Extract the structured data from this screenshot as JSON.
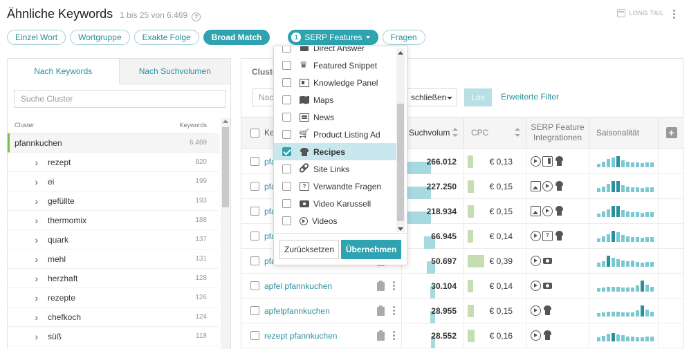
{
  "header": {
    "title": "Ähnliche Keywords",
    "count": "1 bis 25 von 6.469",
    "help": "?",
    "longtail": "LONG TAIL"
  },
  "match_types": [
    "Einzel Wort",
    "Wortgruppe",
    "Exakte Folge",
    "Broad Match"
  ],
  "active_match": "Broad Match",
  "serp_filter": {
    "badge": "1",
    "label": "SERP Features"
  },
  "questions_pill": "Fragen",
  "left": {
    "tabs": [
      "Nach Keywords",
      "Nach Suchvolumen"
    ],
    "search_placeholder": "Suche Cluster",
    "col_cluster": "Cluster",
    "col_keywords": "Keywords",
    "root": {
      "name": "pfannkuchen",
      "count": "6.469"
    },
    "items": [
      {
        "name": "rezept",
        "count": "820"
      },
      {
        "name": "ei",
        "count": "199"
      },
      {
        "name": "gefüllte",
        "count": "193"
      },
      {
        "name": "thermomix",
        "count": "188"
      },
      {
        "name": "quark",
        "count": "137"
      },
      {
        "name": "mehl",
        "count": "131"
      },
      {
        "name": "herzhaft",
        "count": "128"
      },
      {
        "name": "rezepte",
        "count": "126"
      },
      {
        "name": "chefkoch",
        "count": "124"
      },
      {
        "name": "süß",
        "count": "118"
      }
    ]
  },
  "main": {
    "label": "Cluste",
    "search_placeholder": "Nac",
    "exclude_select": "schließen",
    "go_button": "Los",
    "advanced_filter": "Erweiterte Filter",
    "columns": {
      "keyword": "Ke",
      "volume": "Suchvolum",
      "cpc": "CPC",
      "serp": "SERP Feature Integrationen",
      "season": "Saisonalität",
      "add": "+"
    },
    "rows": [
      {
        "kw": "pfa",
        "volume": "266.012",
        "cpc": "€ 0,13",
        "vol_pct": 1.0,
        "cpc_pct": 0.2,
        "icons": [
          "play-icon",
          "panel-icon",
          "chef-hat-icon"
        ],
        "season": [
          5,
          8,
          12,
          14,
          16,
          10,
          8,
          7,
          7,
          6,
          7,
          7
        ]
      },
      {
        "kw": "pfa",
        "volume": "227.250",
        "cpc": "€ 0,15",
        "vol_pct": 0.86,
        "cpc_pct": 0.23,
        "icons": [
          "image-icon",
          "play-icon",
          "chef-hat-icon"
        ],
        "season": [
          6,
          8,
          12,
          16,
          16,
          10,
          8,
          7,
          7,
          6,
          7,
          7
        ]
      },
      {
        "kw": "pfa",
        "volume": "218.934",
        "cpc": "€ 0,15",
        "vol_pct": 0.82,
        "cpc_pct": 0.23,
        "icons": [
          "image-icon",
          "play-icon",
          "chef-hat-icon"
        ],
        "season": [
          5,
          8,
          11,
          16,
          16,
          10,
          8,
          7,
          7,
          6,
          7,
          7
        ]
      },
      {
        "kw": "pfa",
        "volume": "66.945",
        "cpc": "€ 0,14",
        "vol_pct": 0.25,
        "cpc_pct": 0.2,
        "icons": [
          "play-icon",
          "faq-icon",
          "chef-hat-icon"
        ],
        "season": [
          5,
          8,
          11,
          16,
          14,
          10,
          8,
          7,
          7,
          6,
          7,
          7
        ]
      },
      {
        "kw": "pfa",
        "volume": "50.697",
        "cpc": "€ 0,39",
        "vol_pct": 0.19,
        "cpc_pct": 0.6,
        "icons": [
          "play-icon",
          "video-carousel-icon"
        ],
        "season": [
          6,
          8,
          16,
          13,
          11,
          9,
          8,
          9,
          7,
          6,
          7,
          7
        ]
      },
      {
        "kw": "apfel pfannkuchen",
        "volume": "30.104",
        "cpc": "€ 0,14",
        "vol_pct": 0.11,
        "cpc_pct": 0.2,
        "icons": [
          "play-icon",
          "video-carousel-icon"
        ],
        "season": [
          5,
          6,
          7,
          7,
          7,
          6,
          6,
          6,
          9,
          16,
          10,
          7
        ]
      },
      {
        "kw": "apfelpfannkuchen",
        "volume": "28.955",
        "cpc": "€ 0,15",
        "vol_pct": 0.11,
        "cpc_pct": 0.23,
        "icons": [
          "play-icon",
          "chef-hat-icon"
        ],
        "season": [
          5,
          6,
          7,
          7,
          7,
          6,
          6,
          6,
          9,
          16,
          10,
          7
        ]
      },
      {
        "kw": "rezept pfannkuchen",
        "volume": "28.552",
        "cpc": "€ 0,16",
        "vol_pct": 0.1,
        "cpc_pct": 0.25,
        "icons": [
          "play-icon",
          "chef-hat-icon"
        ],
        "season": [
          6,
          8,
          11,
          12,
          10,
          9,
          7,
          7,
          6,
          6,
          7,
          7
        ]
      }
    ]
  },
  "dropdown": {
    "partial_item": "Direct Answer",
    "items": [
      {
        "label": "Featured Snippet",
        "icon": "crown-icon",
        "checked": false
      },
      {
        "label": "Knowledge Panel",
        "icon": "panel-icon",
        "checked": false
      },
      {
        "label": "Maps",
        "icon": "map-icon",
        "checked": false
      },
      {
        "label": "News",
        "icon": "news-icon",
        "checked": false
      },
      {
        "label": "Product Listing Ad",
        "icon": "cart-icon",
        "checked": false
      },
      {
        "label": "Recipes",
        "icon": "chef-hat-icon",
        "checked": true
      },
      {
        "label": "Site Links",
        "icon": "link-icon",
        "checked": false
      },
      {
        "label": "Verwandte Fragen",
        "icon": "faq-icon",
        "checked": false
      },
      {
        "label": "Video Karussell",
        "icon": "video-carousel-icon",
        "checked": false
      },
      {
        "label": "Videos",
        "icon": "play-icon",
        "checked": false
      }
    ],
    "reset": "Zurücksetzen",
    "apply": "Übernehmen"
  },
  "colors": {
    "accent": "#2fa3b0",
    "link": "#2a8f9e",
    "volume_bar": "#a7d9e1",
    "cpc_bar": "#c6dcb1",
    "cluster_marker": "#7fbf4a"
  }
}
